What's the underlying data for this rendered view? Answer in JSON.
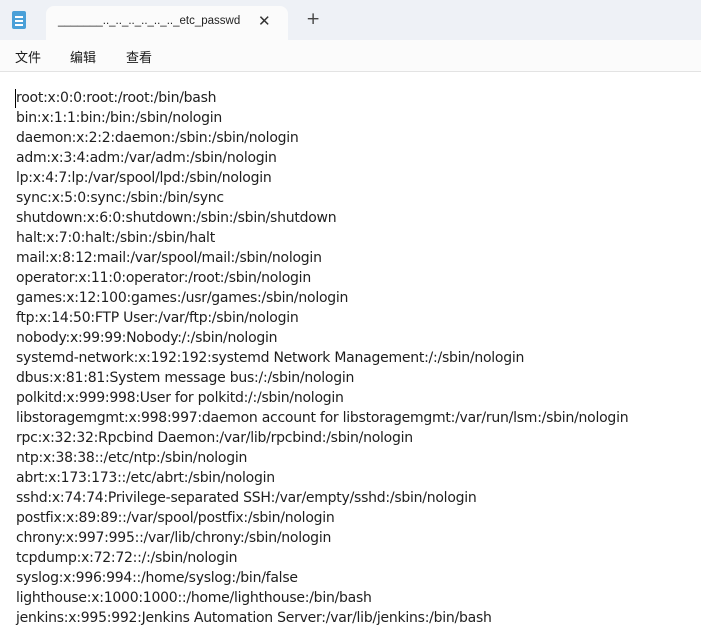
{
  "tab": {
    "title": "_______.._.._.._.._.._.._etc_passwd",
    "close_glyph": "✕",
    "new_tab_glyph": "+"
  },
  "menu": {
    "file": "文件",
    "edit": "编辑",
    "view": "查看"
  },
  "content": {
    "lines": [
      "root:x:0:0:root:/root:/bin/bash",
      "bin:x:1:1:bin:/bin:/sbin/nologin",
      "daemon:x:2:2:daemon:/sbin:/sbin/nologin",
      "adm:x:3:4:adm:/var/adm:/sbin/nologin",
      "lp:x:4:7:lp:/var/spool/lpd:/sbin/nologin",
      "sync:x:5:0:sync:/sbin:/bin/sync",
      "shutdown:x:6:0:shutdown:/sbin:/sbin/shutdown",
      "halt:x:7:0:halt:/sbin:/sbin/halt",
      "mail:x:8:12:mail:/var/spool/mail:/sbin/nologin",
      "operator:x:11:0:operator:/root:/sbin/nologin",
      "games:x:12:100:games:/usr/games:/sbin/nologin",
      "ftp:x:14:50:FTP User:/var/ftp:/sbin/nologin",
      "nobody:x:99:99:Nobody:/:/sbin/nologin",
      "systemd-network:x:192:192:systemd Network Management:/:/sbin/nologin",
      "dbus:x:81:81:System message bus:/:/sbin/nologin",
      "polkitd:x:999:998:User for polkitd:/:/sbin/nologin",
      "libstoragemgmt:x:998:997:daemon account for libstoragemgmt:/var/run/lsm:/sbin/nologin",
      "rpc:x:32:32:Rpcbind Daemon:/var/lib/rpcbind:/sbin/nologin",
      "ntp:x:38:38::/etc/ntp:/sbin/nologin",
      "abrt:x:173:173::/etc/abrt:/sbin/nologin",
      "sshd:x:74:74:Privilege-separated SSH:/var/empty/sshd:/sbin/nologin",
      "postfix:x:89:89::/var/spool/postfix:/sbin/nologin",
      "chrony:x:997:995::/var/lib/chrony:/sbin/nologin",
      "tcpdump:x:72:72::/:/sbin/nologin",
      "syslog:x:996:994::/home/syslog:/bin/false",
      "lighthouse:x:1000:1000::/home/lighthouse:/bin/bash",
      "jenkins:x:995:992:Jenkins Automation Server:/var/lib/jenkins:/bin/bash"
    ]
  }
}
